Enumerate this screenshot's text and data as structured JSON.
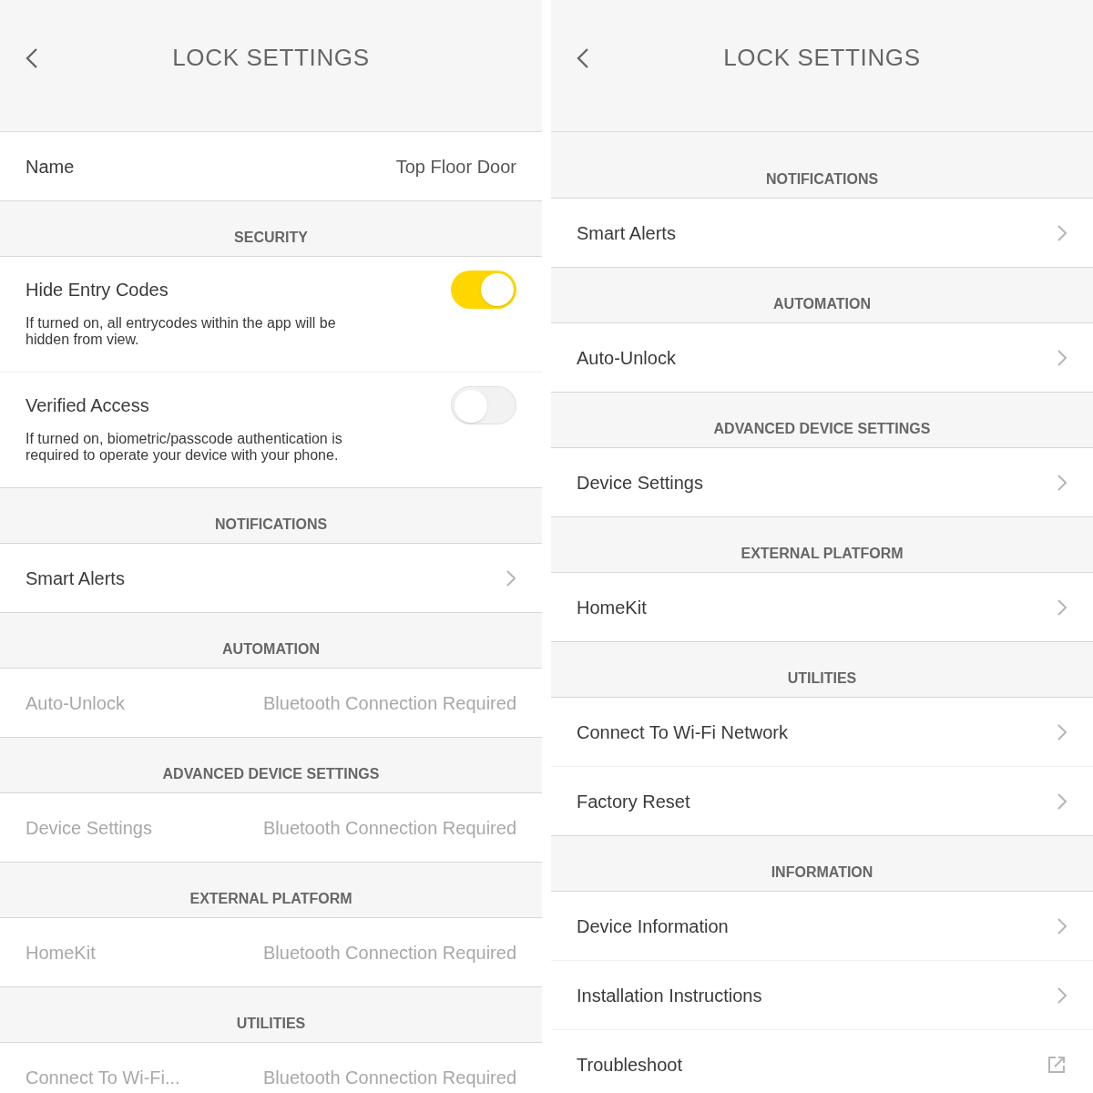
{
  "panels": [
    {
      "title": "LOCK SETTINGS",
      "sections": [
        {
          "items": [
            {
              "kind": "value",
              "label": "Name",
              "value": "Top Floor Door"
            }
          ]
        },
        {
          "header": "SECURITY",
          "items": [
            {
              "kind": "toggle",
              "label": "Hide Entry Codes",
              "on": true,
              "description": "If turned on, all entrycodes within the app will be hidden from view."
            },
            {
              "kind": "toggle",
              "label": "Verified Access",
              "on": false,
              "description": "If turned on, biometric/passcode authentication is required to operate your device with your phone."
            }
          ]
        },
        {
          "header": "NOTIFICATIONS",
          "items": [
            {
              "kind": "link",
              "label": "Smart Alerts"
            }
          ]
        },
        {
          "header": "AUTOMATION",
          "items": [
            {
              "kind": "unavailable",
              "label": "Auto-Unlock",
              "value": "Bluetooth Connection Required"
            }
          ]
        },
        {
          "header": "ADVANCED DEVICE SETTINGS",
          "items": [
            {
              "kind": "unavailable",
              "label": "Device Settings",
              "value": "Bluetooth Connection Required"
            }
          ]
        },
        {
          "header": "EXTERNAL PLATFORM",
          "items": [
            {
              "kind": "unavailable",
              "label": "HomeKit",
              "value": "Bluetooth Connection Required"
            }
          ]
        },
        {
          "header": "UTILITIES",
          "items": [
            {
              "kind": "unavailable",
              "label": "Connect To Wi-Fi...",
              "value": "Bluetooth Connection Required"
            }
          ]
        }
      ]
    },
    {
      "title": "LOCK SETTINGS",
      "sections": [
        {
          "header": "NOTIFICATIONS",
          "items": [
            {
              "kind": "link",
              "label": "Smart Alerts"
            }
          ]
        },
        {
          "header": "AUTOMATION",
          "items": [
            {
              "kind": "link",
              "label": "Auto-Unlock"
            }
          ]
        },
        {
          "header": "ADVANCED DEVICE SETTINGS",
          "items": [
            {
              "kind": "link",
              "label": "Device Settings"
            }
          ]
        },
        {
          "header": "EXTERNAL PLATFORM",
          "items": [
            {
              "kind": "link",
              "label": "HomeKit"
            }
          ]
        },
        {
          "header": "UTILITIES",
          "items": [
            {
              "kind": "link",
              "label": "Connect To Wi-Fi Network"
            },
            {
              "kind": "link",
              "label": "Factory Reset"
            }
          ]
        },
        {
          "header": "INFORMATION",
          "items": [
            {
              "kind": "link",
              "label": "Device Information"
            },
            {
              "kind": "link",
              "label": "Installation Instructions"
            },
            {
              "kind": "external",
              "label": "Troubleshoot"
            }
          ]
        }
      ]
    }
  ]
}
